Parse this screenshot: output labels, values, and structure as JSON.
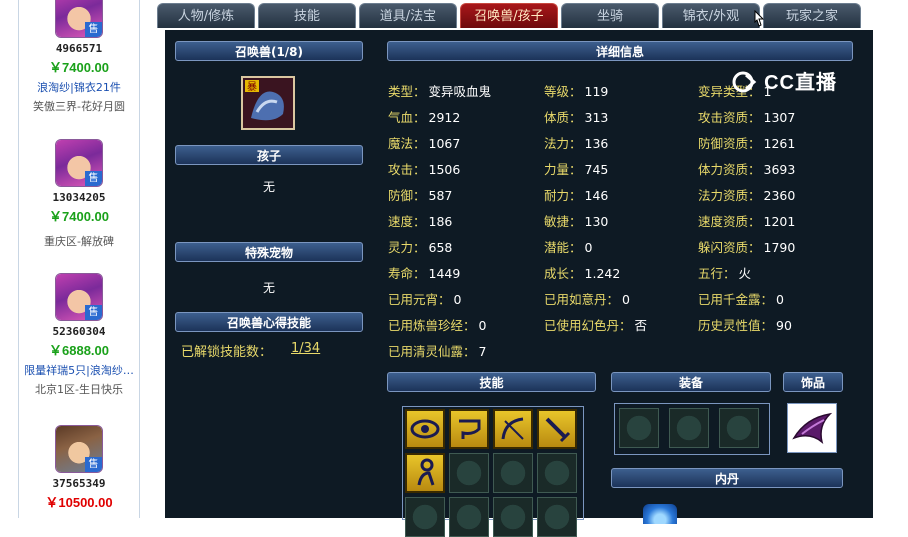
{
  "listings": [
    {
      "id": "4966571",
      "price": "￥7400.00",
      "price_color": "green",
      "tag": "浪淘纱|锦衣21件",
      "server": "笑傲三界-花好月圆",
      "avatar": "girl"
    },
    {
      "id": "13034205",
      "price": "￥7400.00",
      "price_color": "green",
      "tag": "",
      "server": "重庆区-解放碑",
      "avatar": "girl"
    },
    {
      "id": "52360304",
      "price": "￥6888.00",
      "price_color": "green",
      "tag": "限量祥瑞5只|浪淘纱…",
      "server": "北京1区-生日快乐",
      "avatar": "girl"
    },
    {
      "id": "37565349",
      "price": "￥10500.00",
      "price_color": "red",
      "tag": "",
      "server": "",
      "avatar": "boy"
    }
  ],
  "sell_badge": "售",
  "tabs": [
    "人物/修炼",
    "技能",
    "道具/法宝",
    "召唤兽/孩子",
    "坐骑",
    "锦衣/外观",
    "玩家之家"
  ],
  "active_tab": "召唤兽/孩子",
  "pet_header": "召唤兽(1/8)",
  "pet_icon_badge": "暴",
  "child_header": "孩子",
  "child_value": "无",
  "special_pet_header": "特殊宠物",
  "special_pet_value": "无",
  "skill_insight_header": "召唤兽心得技能",
  "unlocked_label": "已解锁技能数：",
  "unlocked_value": "1/34",
  "detail_header": "详细信息",
  "attrs_col1": [
    {
      "k": "类型：",
      "v": "变异吸血鬼"
    },
    {
      "k": "气血：",
      "v": "2912"
    },
    {
      "k": "魔法：",
      "v": "1067"
    },
    {
      "k": "攻击：",
      "v": "1506"
    },
    {
      "k": "防御：",
      "v": "587"
    },
    {
      "k": "速度：",
      "v": "186"
    },
    {
      "k": "灵力：",
      "v": "658"
    },
    {
      "k": "寿命：",
      "v": "1449"
    },
    {
      "k": "已用元宵：",
      "v": "0"
    },
    {
      "k": "已用炼兽珍经：",
      "v": "0"
    },
    {
      "k": "已用清灵仙露：",
      "v": "7"
    }
  ],
  "attrs_col2": [
    {
      "k": "等级：",
      "v": "119"
    },
    {
      "k": "体质：",
      "v": "313"
    },
    {
      "k": "法力：",
      "v": "136"
    },
    {
      "k": "力量：",
      "v": "745"
    },
    {
      "k": "耐力：",
      "v": "146"
    },
    {
      "k": "敏捷：",
      "v": "130"
    },
    {
      "k": "潜能：",
      "v": "0"
    },
    {
      "k": "成长：",
      "v": "1.242"
    },
    {
      "k": "已用如意丹：",
      "v": "0"
    },
    {
      "k": "已使用幻色丹：",
      "v": "否"
    }
  ],
  "attrs_col3": [
    {
      "k": "变异类型：",
      "v": "1"
    },
    {
      "k": "攻击资质：",
      "v": "1307"
    },
    {
      "k": "防御资质：",
      "v": "1261"
    },
    {
      "k": "体力资质：",
      "v": "3693"
    },
    {
      "k": "法力资质：",
      "v": "2360"
    },
    {
      "k": "速度资质：",
      "v": "1201"
    },
    {
      "k": "躲闪资质：",
      "v": "1790"
    },
    {
      "k": "五行：",
      "v": "火"
    },
    {
      "k": "已用千金露：",
      "v": "0"
    },
    {
      "k": "历史灵性值：",
      "v": "90"
    }
  ],
  "skills_header": "技能",
  "equip_header": "装备",
  "ornament_header": "饰品",
  "inner_dan_header": "内丹",
  "watermark": "CC直播",
  "colors": {
    "panel_bg": "#0e1a24",
    "label_yellow": "#e8d96a",
    "price_green": "#1aa11a",
    "price_red": "#e00000",
    "active_tab": "#a8171a"
  }
}
